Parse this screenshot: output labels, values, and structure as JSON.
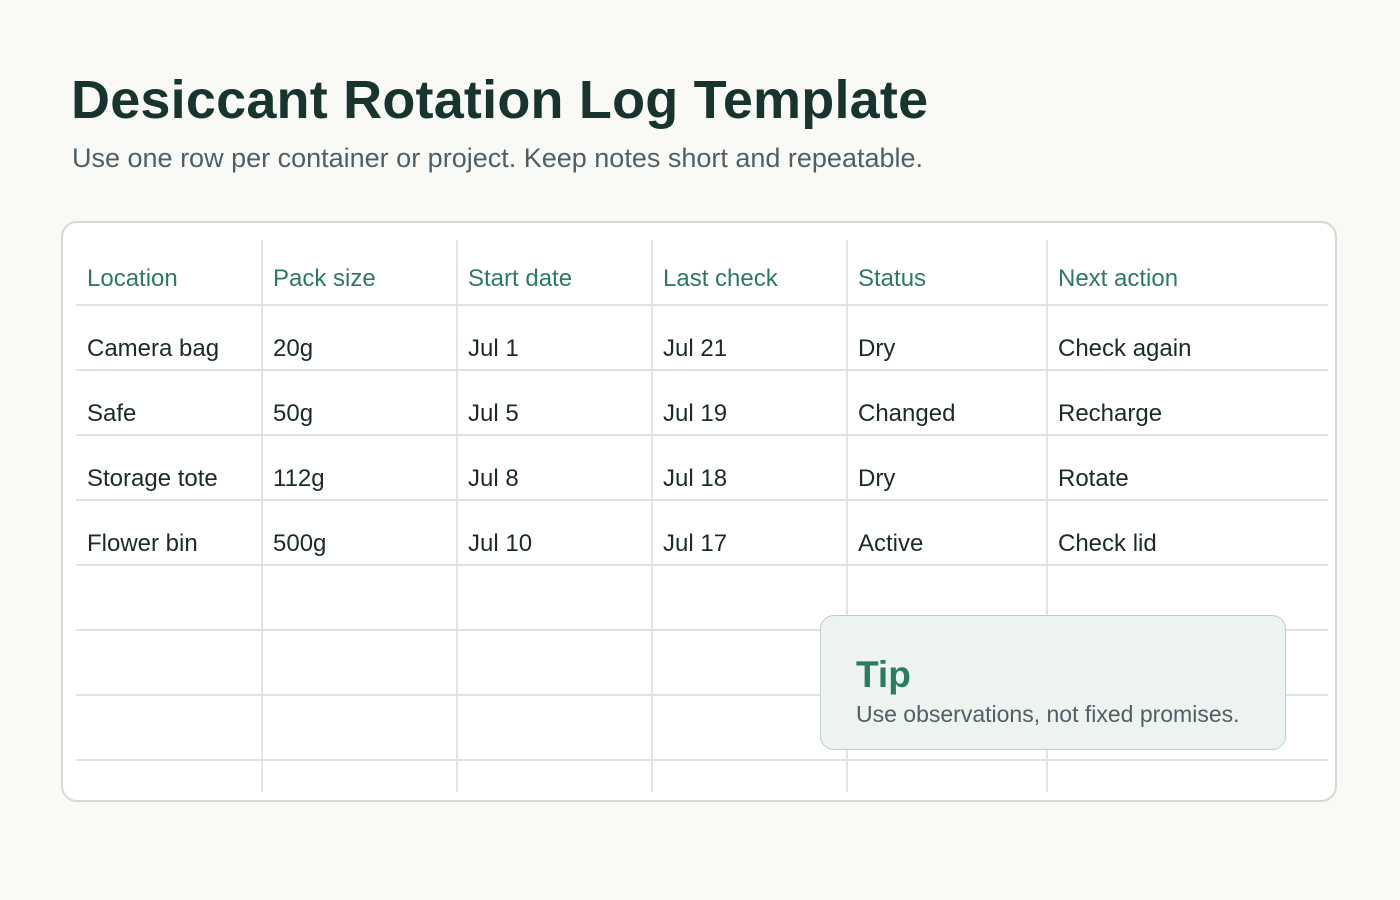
{
  "title": "Desiccant Rotation Log Template",
  "subtitle": "Use one row per container or project. Keep notes short and repeatable.",
  "table": {
    "columns": [
      "Location",
      "Pack size",
      "Start date",
      "Last check",
      "Status",
      "Next action"
    ],
    "rows": [
      [
        "Camera bag",
        "20g",
        "Jul 1",
        "Jul 21",
        "Dry",
        "Check again"
      ],
      [
        "Safe",
        "50g",
        "Jul 5",
        "Jul 19",
        "Changed",
        "Recharge"
      ],
      [
        "Storage tote",
        "112g",
        "Jul 8",
        "Jul 18",
        "Dry",
        "Rotate"
      ],
      [
        "Flower bin",
        "500g",
        "Jul 10",
        "Jul 17",
        "Active",
        "Check lid"
      ]
    ]
  },
  "tip": {
    "title": "Tip",
    "text": "Use observations, not fixed promises."
  },
  "colors": {
    "background": "#f9faf6",
    "title": "#17342e",
    "accent": "#2b7a62",
    "muted_text": "#4f5f68",
    "tip_background": "#edf3ef"
  }
}
